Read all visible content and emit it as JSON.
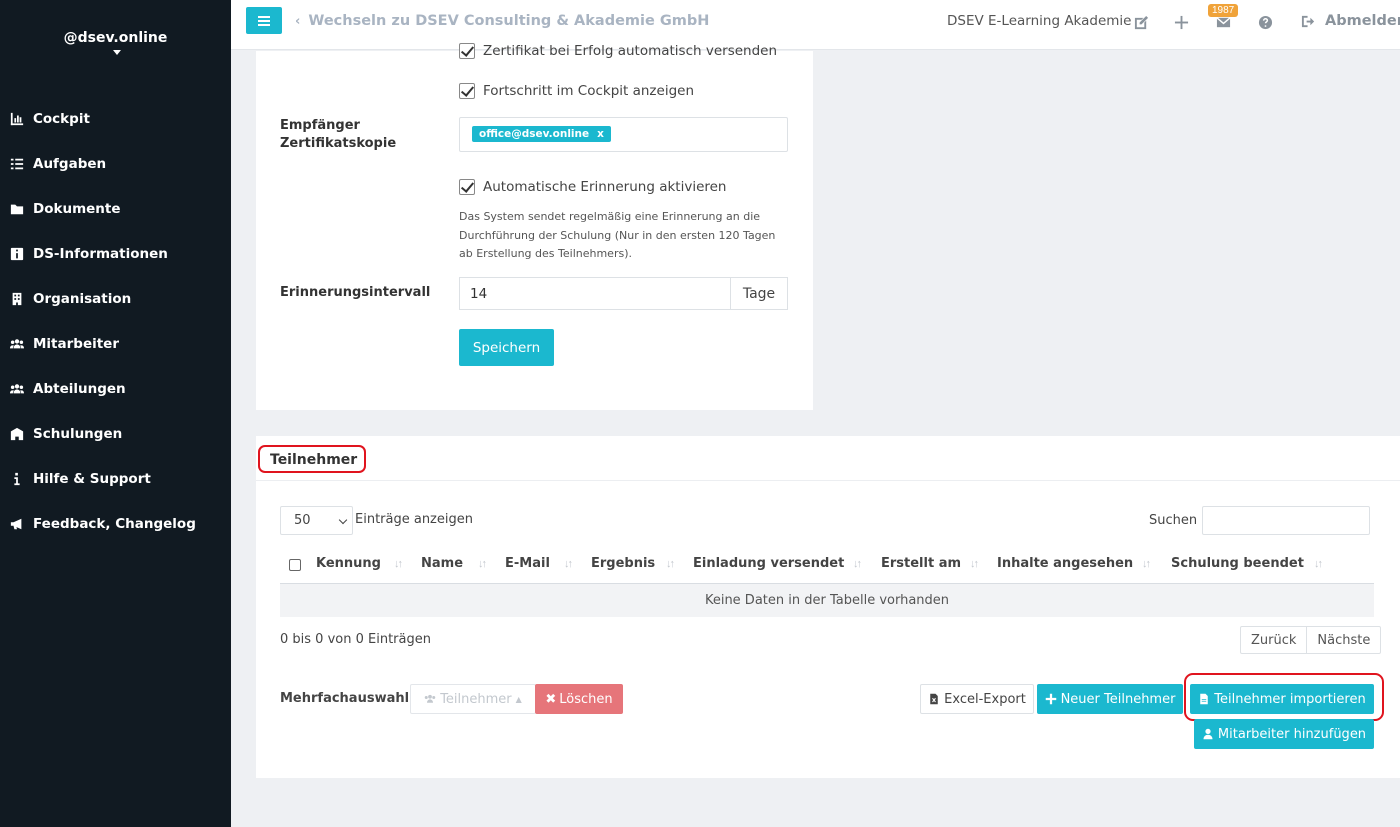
{
  "sidebar": {
    "brand": "@dsev.online",
    "items": [
      {
        "label": "Cockpit",
        "icon": "chart-icon"
      },
      {
        "label": "Aufgaben",
        "icon": "list-icon"
      },
      {
        "label": "Dokumente",
        "icon": "folder-icon"
      },
      {
        "label": "DS-Informationen",
        "icon": "info-icon"
      },
      {
        "label": "Organisation",
        "icon": "building-icon"
      },
      {
        "label": "Mitarbeiter",
        "icon": "users-icon"
      },
      {
        "label": "Abteilungen",
        "icon": "users-icon"
      },
      {
        "label": "Schulungen",
        "icon": "school-icon"
      },
      {
        "label": "Hilfe & Support",
        "icon": "info-icon"
      },
      {
        "label": "Feedback, Changelog",
        "icon": "megaphone-icon"
      }
    ]
  },
  "topbar": {
    "switch_label": "Wechseln zu DSEV Consulting & Akademie GmbH",
    "org_name": "DSEV E-Learning Akademie",
    "badge_count": "1987",
    "logout_label": "Abmelden"
  },
  "settings": {
    "check_cert_send": "Zertifikat bei Erfolg automatisch versenden",
    "check_progress": "Fortschritt im Cockpit anzeigen",
    "cert_copy_label_line1": "Empfänger",
    "cert_copy_label_line2": "Zertifikatskopie",
    "cert_copy_tag": "office@dsev.online",
    "tag_remove": "x",
    "check_reminder": "Automatische Erinnerung aktivieren",
    "reminder_help": "Das System sendet regelmäßig eine Erinnerung an die Durchführung der Schulung (Nur in den ersten 120 Tagen ab Erstellung des Teilnehmers).",
    "interval_label": "Erinnerungsintervall",
    "interval_value": "14",
    "interval_unit": "Tage",
    "save_label": "Speichern"
  },
  "participants": {
    "title": "Teilnehmer",
    "page_length": "50",
    "page_length_label": "Einträge anzeigen",
    "search_label": "Suchen",
    "columns": [
      "Kennung",
      "Name",
      "E-Mail",
      "Ergebnis",
      "Einladung versendet",
      "Erstellt am",
      "Inhalte angesehen",
      "Schulung beendet"
    ],
    "empty_text": "Keine Daten in der Tabelle vorhanden",
    "info_text": "0 bis 0 von 0 Einträgen",
    "prev_label": "Zurück",
    "next_label": "Nächste",
    "bulk_label": "Mehrfachauswahl:",
    "bulk_participants": "Teilnehmer",
    "bulk_delete": "Löschen",
    "excel_export": "Excel-Export",
    "new_participant": "Neuer Teilnehmer",
    "import_participants": "Teilnehmer importieren",
    "add_employees": "Mitarbeiter hinzufügen"
  },
  "colors": {
    "accent": "#1bb8cf",
    "sidebar_bg": "#111a22",
    "delete": "#e6757a",
    "highlight": "#e0141e",
    "badge": "#f0a33a"
  }
}
